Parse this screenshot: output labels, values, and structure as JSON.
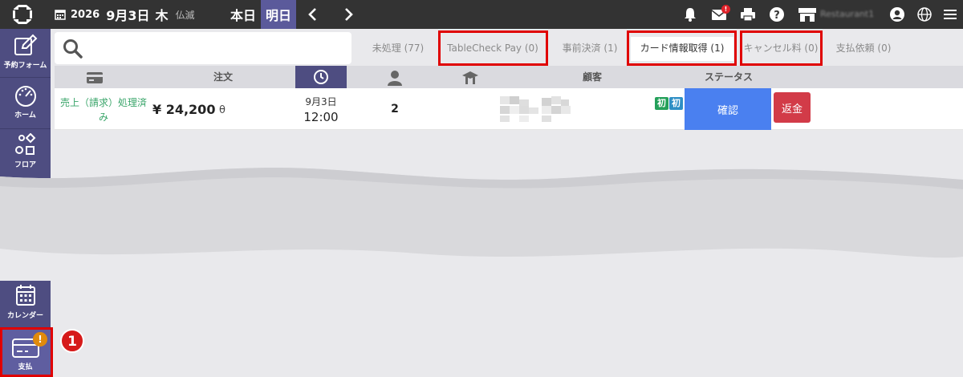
{
  "topbar": {
    "year": "2026",
    "month_day": "9月3日",
    "weekday": "木",
    "rokuyo": "仏滅",
    "today_label": "本日",
    "tomorrow_label": "明日",
    "mail_badge": "!",
    "restaurant_name": "Restaurant1"
  },
  "sidebar": {
    "items": [
      {
        "label": "予約フォーム",
        "icon": "edit-icon"
      },
      {
        "label": "ホーム",
        "icon": "dashboard-icon"
      },
      {
        "label": "フロア",
        "icon": "floor-shapes-icon"
      },
      {
        "label": "カレンダー",
        "icon": "calendar-icon"
      },
      {
        "label": "支払",
        "icon": "credit-card-icon",
        "alert": "!"
      }
    ]
  },
  "search": {
    "value": "",
    "placeholder": ""
  },
  "tabs": [
    {
      "label": "未処理 (77)"
    },
    {
      "label": "TableCheck Pay (0)"
    },
    {
      "label": "事前決済 (1)"
    },
    {
      "label": "カード情報取得 (1)"
    },
    {
      "label": "キャンセル料 (0)"
    },
    {
      "label": "支払依頼 (0)"
    }
  ],
  "table": {
    "headers": {
      "order": "注文",
      "customer": "顧客",
      "status": "ステータス"
    },
    "rows": [
      {
        "payment_status": "売上（請求）処理済み",
        "amount": "¥ 24,200",
        "amount_symbol": "θ",
        "date": "9月3日",
        "time": "12:00",
        "party_size": "2",
        "tag_first": "初",
        "tag_second": "初",
        "confirm_label": "確認",
        "refund_label": "返金"
      }
    ]
  },
  "annotation": {
    "step": "1"
  },
  "colors": {
    "topbar": "#333333",
    "sidebar": "#4e4d81",
    "accent": "#5b5a9b",
    "confirm": "#4a80f0",
    "refund": "#d23b48",
    "highlight": "#e00000",
    "paid_text": "#3aa56a"
  }
}
